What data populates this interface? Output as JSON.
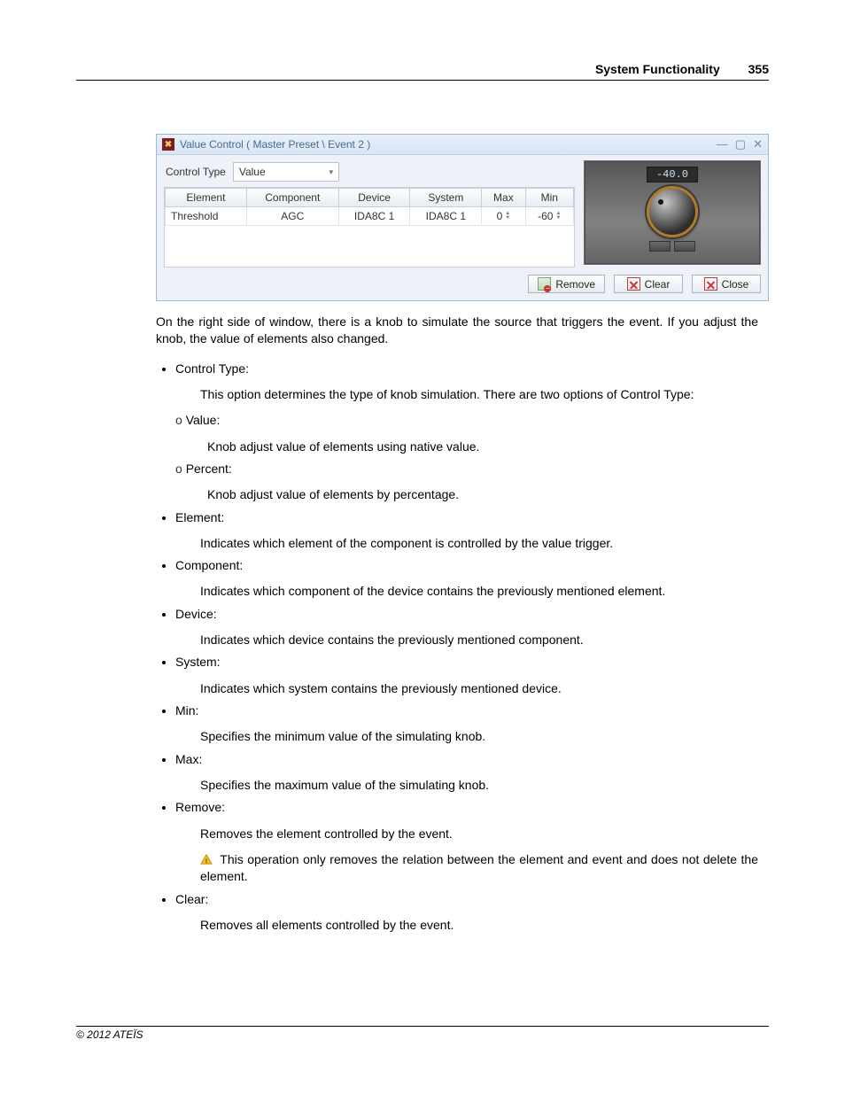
{
  "header": {
    "section": "System Functionality",
    "page_number": "355"
  },
  "dialog": {
    "title": "Value Control ( Master Preset \\ Event 2 )",
    "control_type_label": "Control Type",
    "control_type_value": "Value",
    "columns": [
      "Element",
      "Component",
      "Device",
      "System",
      "Max",
      "Min"
    ],
    "row": {
      "element": "Threshold",
      "component": "AGC",
      "device": "IDA8C 1",
      "system": "IDA8C 1",
      "max": "0",
      "min": "-60"
    },
    "knob_value": "-40.0",
    "buttons": {
      "remove": "Remove",
      "clear": "Clear",
      "close": "Close"
    }
  },
  "doc": {
    "intro": "On the right side of window, there is a knob to simulate the source that triggers the event. If you adjust the knob, the value of elements also changed.",
    "items": {
      "control_type": {
        "title": "Control Type:",
        "desc": "This option determines the type of knob simulation. There are two options of Control Type:",
        "value_title": "Value:",
        "value_desc": "Knob adjust value of elements using native value.",
        "percent_title": "Percent:",
        "percent_desc": "Knob adjust value of elements by percentage."
      },
      "element": {
        "title": "Element:",
        "desc": "Indicates which element of the component is controlled by the value trigger."
      },
      "component": {
        "title": "Component:",
        "desc": "Indicates which component of the device contains the previously mentioned element."
      },
      "device": {
        "title": "Device:",
        "desc": "Indicates which device contains the previously mentioned component."
      },
      "system": {
        "title": "System:",
        "desc": "Indicates which system contains the previously mentioned device."
      },
      "min": {
        "title": "Min:",
        "desc": "Specifies the minimum value of the simulating knob."
      },
      "max": {
        "title": "Max:",
        "desc": "Specifies the maximum value of the simulating knob."
      },
      "remove": {
        "title": "Remove:",
        "desc": "Removes the element controlled by the event.",
        "warn": "This operation only removes the relation between the element and event and does not delete the element."
      },
      "clear": {
        "title": "Clear:",
        "desc": "Removes all elements controlled by the event."
      }
    }
  },
  "footer": "© 2012 ATEÏS"
}
